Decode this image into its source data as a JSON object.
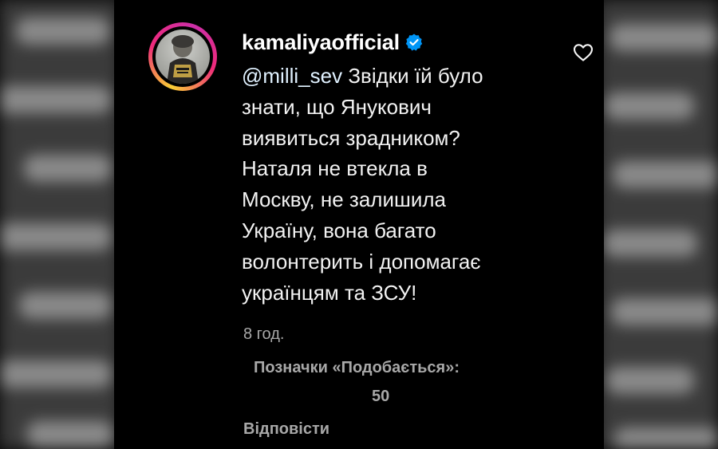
{
  "comment": {
    "username": "kamaliyaofficial",
    "verified": true,
    "mention": "@milli_sev",
    "text_lines": [
      "Звідки їй було",
      "знати, що Янукович",
      "виявиться зрадником?",
      "Наталя не втекла в",
      "Москву, не залишила",
      "Україну, вона багато",
      "волонтерить і допомагає",
      "українцям та ЗСУ!"
    ],
    "time": "8 год.",
    "likes_label": "Позначки «Подобається»:",
    "likes_count": "50",
    "reply_label": "Відповісти"
  },
  "icons": {
    "like": "heart-outline-icon",
    "verified": "verified-badge-icon"
  },
  "colors": {
    "background": "#000000",
    "text": "#f2f2f2",
    "muted": "#a8a8a8",
    "verified": "#0095f6"
  }
}
